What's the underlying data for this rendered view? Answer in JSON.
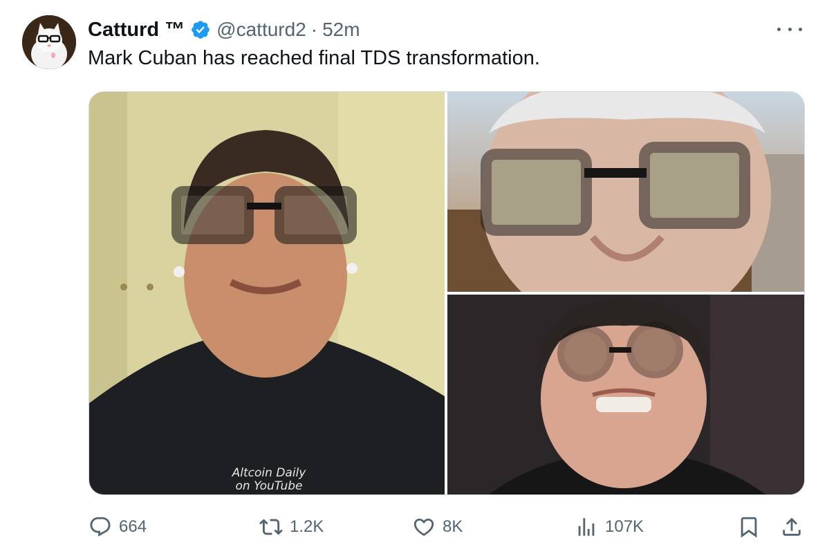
{
  "tweet": {
    "author": {
      "display_name": "Catturd ™",
      "handle": "@catturd2",
      "verified": true,
      "avatar": "cat-with-glasses-avatar"
    },
    "separator": "·",
    "time": "52m",
    "text": "Mark Cuban has reached final TDS transformation.",
    "media": {
      "photos": [
        {
          "name": "man-with-black-glasses-hoodie-photo",
          "watermark_line1": "Altcoin Daily",
          "watermark_line2": "on YouTube"
        },
        {
          "name": "white-haired-man-glasses-closeup-photo"
        },
        {
          "name": "woman-round-glasses-photo"
        }
      ]
    },
    "metrics": {
      "replies": "664",
      "reposts": "1.2K",
      "likes": "8K",
      "views": "107K"
    }
  },
  "icons": {
    "verified": "verified-badge-icon",
    "more": "more-dots-icon",
    "reply": "reply-icon",
    "repost": "repost-icon",
    "like": "heart-icon",
    "views": "views-chart-icon",
    "bookmark": "bookmark-icon",
    "share": "share-icon"
  },
  "colors": {
    "verified_blue": "#1d9bf0",
    "text_primary": "#0f1419",
    "text_secondary": "#536471",
    "border": "#cfd9de"
  }
}
